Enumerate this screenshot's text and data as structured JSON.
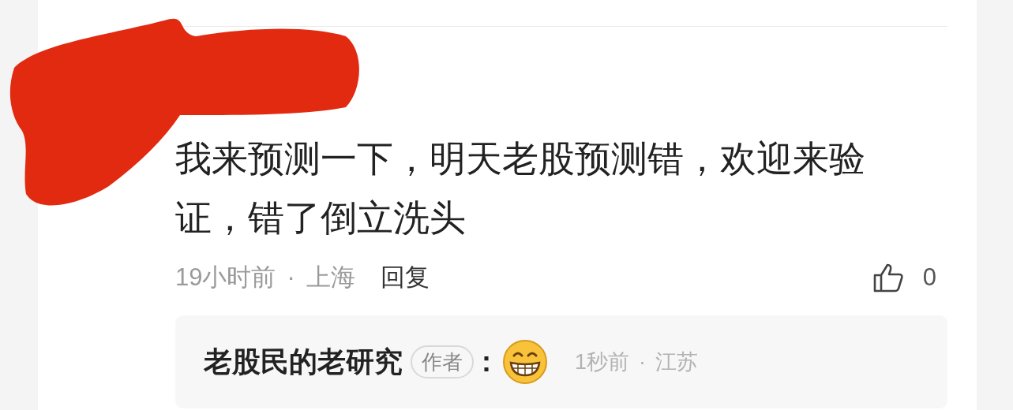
{
  "comment": {
    "text": "我来预测一下，明天老股预测错，欢迎来验证，错了倒立洗头",
    "time": "19小时前",
    "separator": "·",
    "location": "上海",
    "reply_label": "回复",
    "like_count": "0",
    "liked": false
  },
  "reply": {
    "author": "老股民的老研究",
    "badge": "作者",
    "colon": ":",
    "time": "1秒前",
    "separator": "·",
    "location": "江苏"
  }
}
